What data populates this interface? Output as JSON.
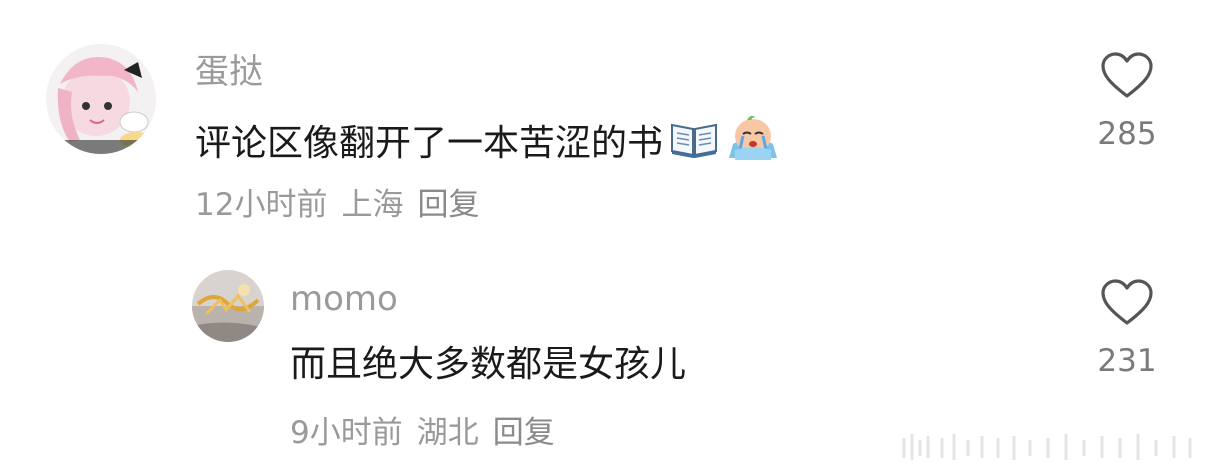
{
  "comments": [
    {
      "username": "蛋挞",
      "text": "评论区像翻开了一本苦涩的书",
      "emojis": [
        "open-book-emoji",
        "crying-face-emoji"
      ],
      "time": "12小时前",
      "location": "上海",
      "reply_label": "回复",
      "likes": "285"
    },
    {
      "username": "momo",
      "text": "而且绝大多数都是女孩儿",
      "time": "9小时前",
      "location": "湖北",
      "reply_label": "回复",
      "likes": "231"
    }
  ],
  "colors": {
    "secondary_text": "#9a9a9a",
    "primary_text": "#1a1a1a",
    "heart_outline": "#555555"
  }
}
